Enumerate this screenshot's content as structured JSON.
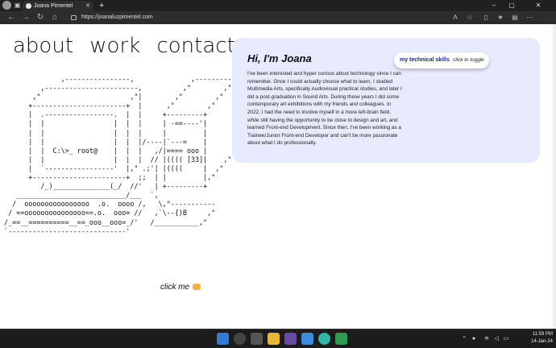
{
  "browser": {
    "tab_title": "Joana Pimentel",
    "url": "https://joanaluzpimentel.com"
  },
  "nav": {
    "about": "about",
    "work": "work",
    "contact": "contact"
  },
  "ascii_art": "               ,----------------,              ,---------\n          ,-----------------------,          ,\"        ,\"|\n        ,\"                      ,\"|        ,\"        ,\"  |\n       +-----------------------+  |      ,\"        ,\"    |\n       |  .-----------------.  |  |     +---------+      |\n       |  |                 |  |  |     | -==----'|      |\n       |  |                 |  |  |     |         |      |\n       |  |                 |  |  |/----|`---=    |      |\n       |  |  C:\\>_ root@    |  |  |   ,/|==== ooo |      ;\n       |  |                 |  |  |  // |(((( [33]|    ,\"\n       |  `-----------------'  |,\" .;'| |((((     |  ,\"\n       +-----------------------+  ;;  | |         |,\"\n          /_)______________(_/  //'   | +---------+\n    ___________________________/___  `,\n   /  oooooooooooooooo  .o.  oooo /,   \\,\"-----------\n  / ==ooooooooooooooo==.o.  ooo= //   ,`\\--{)B     ,\"\n /_==__==========__==_ooo__ooo=_/'   /___________,\"\n `-----------------------------'",
  "click_me": "click me",
  "card": {
    "greeting": "Hi, I'm Joana",
    "bio": "I've been interested and hyper curious about technology since I can remember. Once I could actually choose what to learn, I studied Multimedia Arts, specifically Audiovisual practical studies, and later I did a post-graduation in Sound Arts. During these years I did some contemporary art exhibitions with my friends and colleagues. In 2022, I had the need to involve myself in a more left-brain field, while still having the opportunity to be close to design and art, and learned Front-end Development. Since then, I've been working as a Trainee/Junior Front-end Developer and can't be more passionate about what I do professionally.",
    "skills_label": "my technical skills",
    "skills_hint": "click to toggle"
  },
  "taskbar": {
    "time": "11:59 PM",
    "date": "14-Jan-24"
  },
  "colors": {
    "card_bg": "#e8eafe",
    "accent": "#1a1d9e"
  }
}
